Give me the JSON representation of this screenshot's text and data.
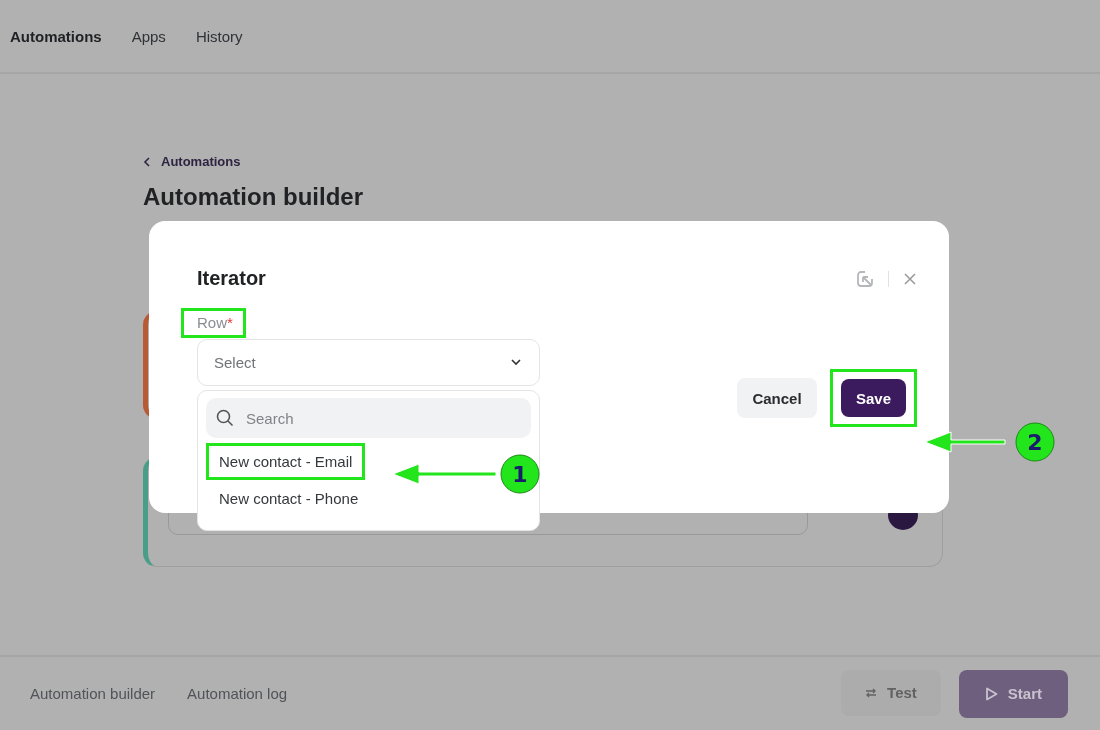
{
  "nav": {
    "items": [
      {
        "label": "Automations",
        "selected": true
      },
      {
        "label": "Apps",
        "selected": false
      },
      {
        "label": "History",
        "selected": false
      }
    ]
  },
  "page": {
    "back_link": "Automations",
    "title": "Automation builder",
    "cards": [
      {
        "color": "#b85a35"
      },
      {
        "color": "#4a9e88"
      }
    ]
  },
  "dialog": {
    "title": "Iterator",
    "field": {
      "label": "Row",
      "required_mark": "*",
      "highlighted": true,
      "placeholder": "Select",
      "expanded": true
    },
    "dropdown": {
      "search_placeholder": "Search",
      "options": [
        {
          "label": "New contact - Email",
          "highlighted": true
        },
        {
          "label": "New contact - Phone",
          "highlighted": false
        }
      ]
    },
    "buttons": [
      {
        "label": "Cancel",
        "kind": "secondary",
        "highlighted": false
      },
      {
        "label": "Save",
        "kind": "primary",
        "highlighted": true
      }
    ]
  },
  "bottom_bar": {
    "tabs": [
      {
        "label": "Automation builder"
      },
      {
        "label": "Automation log"
      }
    ],
    "buttons": [
      {
        "label": "Test",
        "kind": "test",
        "disabled": true
      },
      {
        "label": "Start",
        "kind": "start",
        "disabled": true
      }
    ]
  },
  "annotations": [
    {
      "label": "1"
    },
    {
      "label": "2"
    }
  ]
}
